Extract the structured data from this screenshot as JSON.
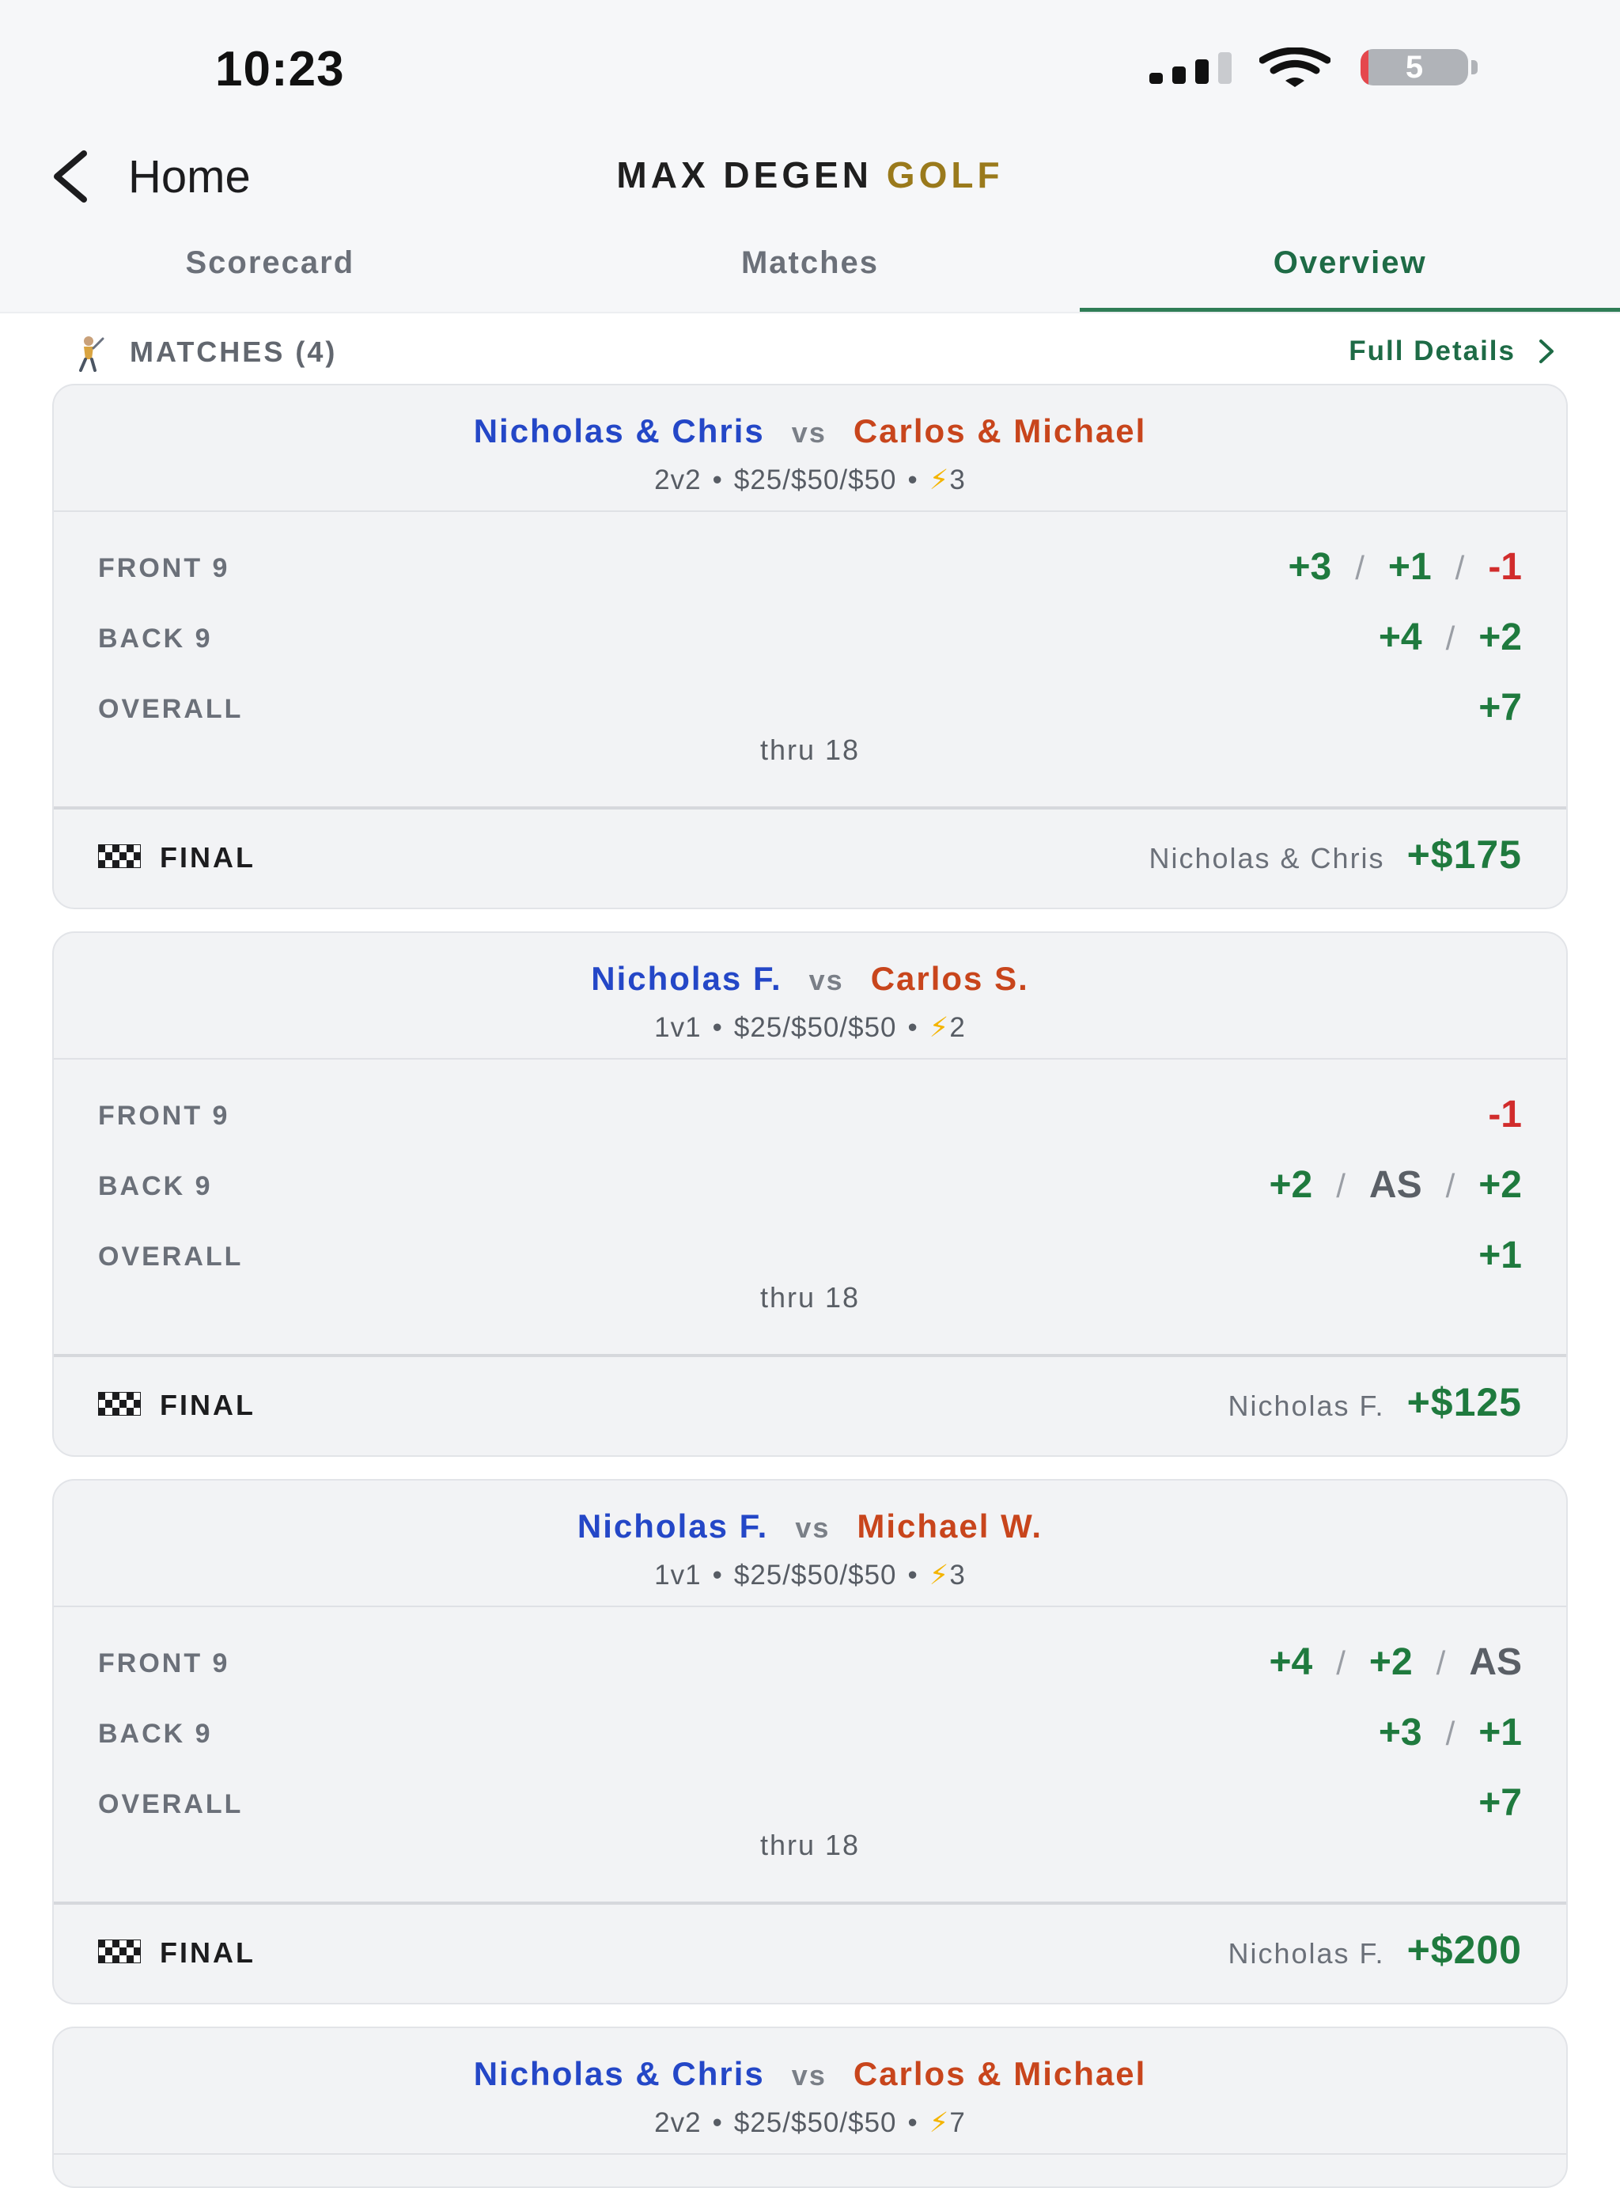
{
  "status_bar": {
    "time": "10:23",
    "battery": "5"
  },
  "nav": {
    "back_label": "Home",
    "title_main": "MAX DEGEN",
    "title_accent": "GOLF"
  },
  "tabs": [
    {
      "label": "Scorecard"
    },
    {
      "label": "Matches"
    },
    {
      "label": "Overview"
    }
  ],
  "active_tab": "Overview",
  "section": {
    "title": "MATCHES (4)",
    "link": "Full Details"
  },
  "labels": {
    "vs": "vs",
    "front": "FRONT 9",
    "back": "BACK 9",
    "overall": "OVERALL",
    "final": "FINAL"
  },
  "colors": {
    "team_a": "#2447c7",
    "team_b": "#c8451c",
    "positive": "#1f7a3e",
    "negative": "#d12c2c",
    "accent": "#9a7a1c"
  },
  "matches": [
    {
      "team_a": "Nicholas & Chris",
      "team_b": "Carlos & Michael",
      "format": "2v2",
      "stakes": "$25/$50/$50",
      "bolts": "3",
      "front": [
        "+3",
        "+1",
        "-1"
      ],
      "back": [
        "+4",
        "+2"
      ],
      "overall": [
        "+7"
      ],
      "thru": "thru 18",
      "winner": "Nicholas & Chris",
      "amount": "+$175"
    },
    {
      "team_a": "Nicholas F.",
      "team_b": "Carlos S.",
      "format": "1v1",
      "stakes": "$25/$50/$50",
      "bolts": "2",
      "front": [
        "-1"
      ],
      "back": [
        "+2",
        "AS",
        "+2"
      ],
      "overall": [
        "+1"
      ],
      "thru": "thru 18",
      "winner": "Nicholas F.",
      "amount": "+$125"
    },
    {
      "team_a": "Nicholas F.",
      "team_b": "Michael W.",
      "format": "1v1",
      "stakes": "$25/$50/$50",
      "bolts": "3",
      "front": [
        "+4",
        "+2",
        "AS"
      ],
      "back": [
        "+3",
        "+1"
      ],
      "overall": [
        "+7"
      ],
      "thru": "thru 18",
      "winner": "Nicholas F.",
      "amount": "+$200"
    },
    {
      "team_a": "Nicholas & Chris",
      "team_b": "Carlos & Michael",
      "format": "2v2",
      "stakes": "$25/$50/$50",
      "bolts": "7"
    }
  ]
}
